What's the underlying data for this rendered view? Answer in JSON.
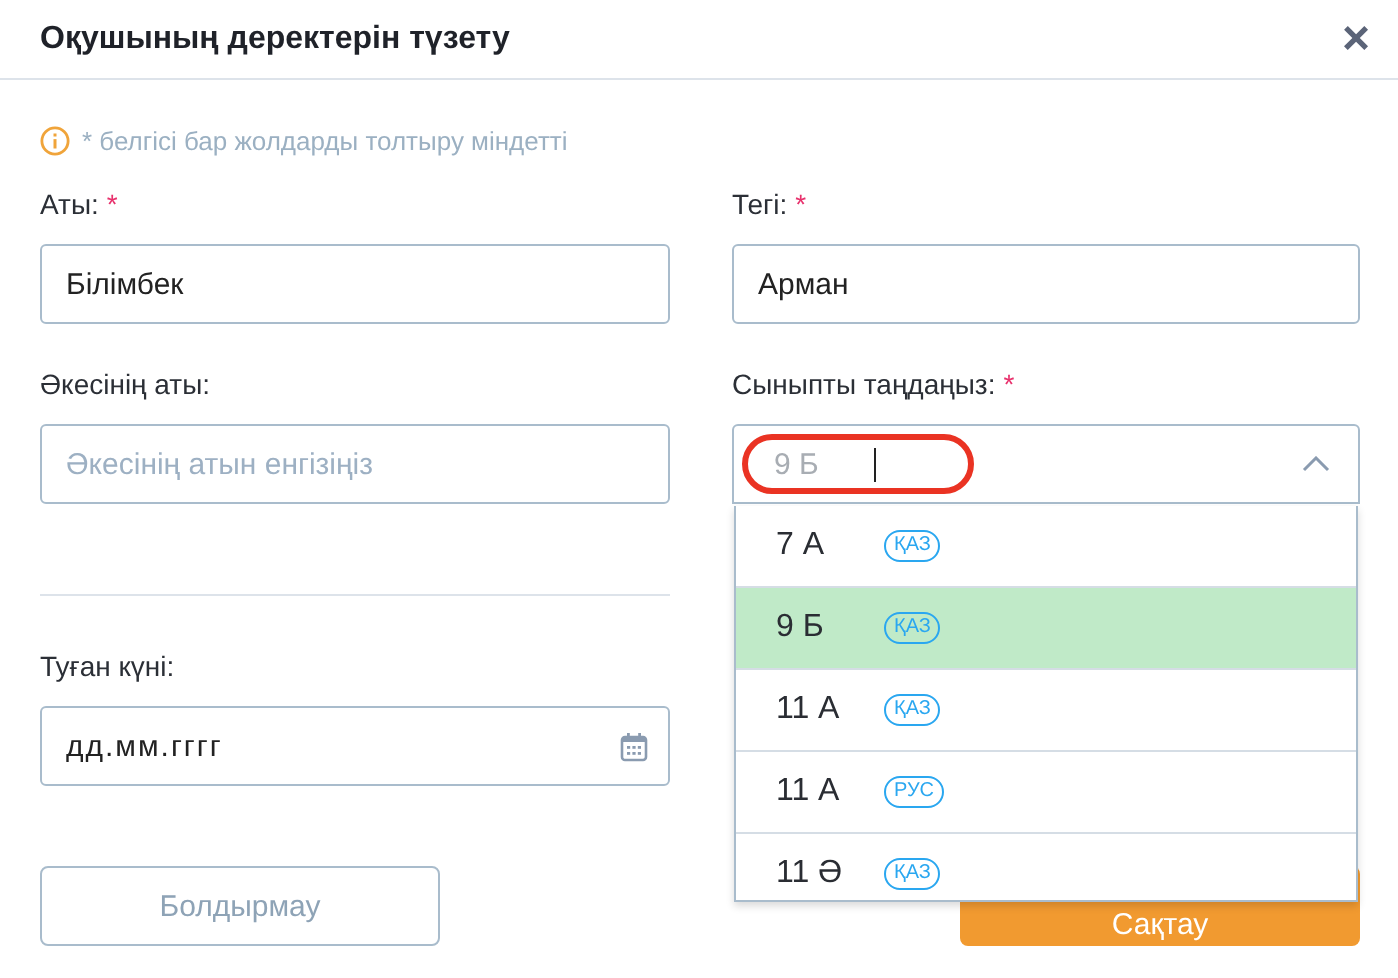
{
  "dialog": {
    "title": "Оқушының деректерін түзету",
    "close": "×"
  },
  "note": "* белгісі бар жолдарды толтыру міндетті",
  "fields": [
    {
      "kind": "text",
      "label": "Аты:",
      "required_mark": "*",
      "value": "Білімбек"
    },
    {
      "kind": "text",
      "label": "Тегі:",
      "required_mark": "*",
      "value": "Арман"
    },
    {
      "kind": "text",
      "label": "Әкесінің аты:",
      "placeholder": "Әкесінің атын енгізіңіз"
    },
    {
      "kind": "select",
      "label": "Сыныпты таңдаңыз:",
      "required_mark": "*",
      "placeholder": "9 Б",
      "expanded": true
    }
  ],
  "birth_date": {
    "label": "Туған күні:",
    "placeholder": "дд.мм.гггг"
  },
  "class_options": [
    {
      "name": "7 А",
      "lang": "ҚАЗ",
      "selected": false
    },
    {
      "name": "9 Б",
      "lang": "ҚАЗ",
      "selected": true
    },
    {
      "name": "11 А",
      "lang": "ҚАЗ",
      "selected": false
    },
    {
      "name": "11 А",
      "lang": "РУС",
      "selected": false
    },
    {
      "name": "11 Ә",
      "lang": "ҚАЗ",
      "selected": false
    }
  ],
  "buttons": {
    "cancel": "Болдырмау",
    "save": "Сақтау"
  }
}
